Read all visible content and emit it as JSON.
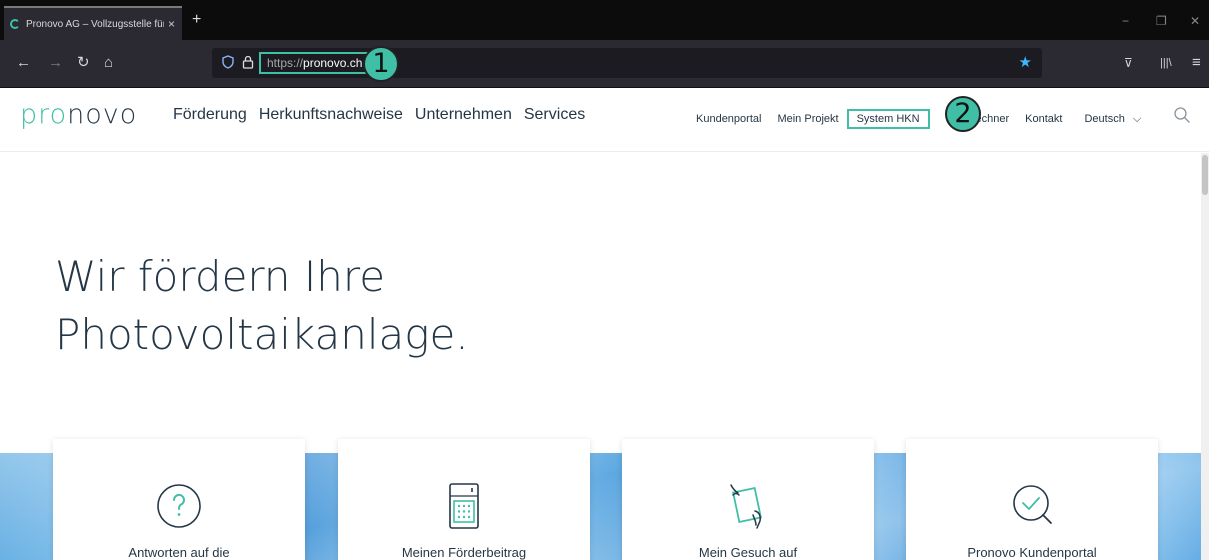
{
  "browser": {
    "tab": {
      "title": "Pronovo AG – Vollzugsstelle für E",
      "close": "×"
    },
    "new_tab": "+",
    "window_controls": {
      "minimize": "−",
      "restore": "❐",
      "close": "✕"
    },
    "nav": {
      "back": "←",
      "forward": "→",
      "reload": "↻",
      "home": "⌂"
    },
    "url": {
      "protocol": "https://",
      "host": "pronovo.ch"
    },
    "bookmark_star": "★",
    "toolbar_right": {
      "pocket": "⊽",
      "library": "|||\\",
      "menu": "≡"
    }
  },
  "callouts": {
    "one": "1",
    "two": "2"
  },
  "site": {
    "logo": {
      "part1": "pro",
      "part2": "novo"
    },
    "main_nav": [
      "Förderung",
      "Herkunftsnachweise",
      "Unternehmen",
      "Services"
    ],
    "secondary_nav": {
      "kundenportal": "Kundenportal",
      "mein_projekt": "Mein Projekt",
      "system_hkn": "System HKN",
      "rechner": "Rechner",
      "kontakt": "Kontakt",
      "language": "Deutsch"
    },
    "hero": {
      "line1": "Wir fördern Ihre",
      "line2": "Photovoltaikanlage."
    },
    "cards": [
      {
        "icon": "question-icon",
        "label": "Antworten auf die"
      },
      {
        "icon": "calculator-icon",
        "label": "Meinen Förderbeitrag"
      },
      {
        "icon": "document-hand-icon",
        "label": "Mein Gesuch auf"
      },
      {
        "icon": "magnifier-check-icon",
        "label": "Pronovo Kundenportal"
      }
    ]
  },
  "colors": {
    "brand_teal": "#3fbfa5",
    "brand_dark": "#253746",
    "browser_bg": "#2b2a33",
    "tabstrip_bg": "#0c0c0d"
  }
}
